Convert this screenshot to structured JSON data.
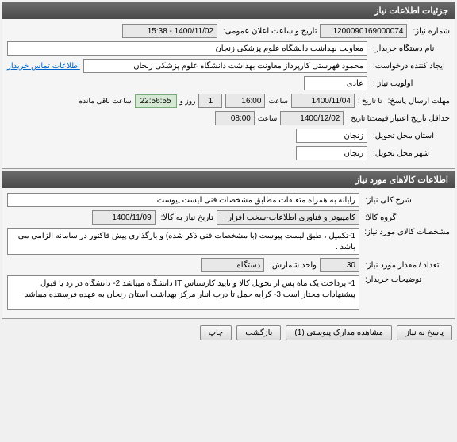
{
  "panel1": {
    "title": "جزئیات اطلاعات نیاز",
    "need_no_label": "شماره نیاز:",
    "need_no": "1200090169000074",
    "pub_label": "تاریخ و ساعت اعلان عمومی:",
    "pub_value": "1400/11/02 - 15:38",
    "buyer_org_label": "نام دستگاه خریدار:",
    "buyer_org": "معاونت بهداشت دانشگاه علوم پزشکی زنجان",
    "creator_label": "ایجاد کننده درخواست:",
    "creator": "محمود فهرستی کارپرداز معاونت بهداشت دانشگاه علوم پزشکی زنجان",
    "contact_link": "اطلاعات تماس خریدار",
    "priority_label": "اولویت نیاز :",
    "priority": "عادی",
    "resp_deadline_label": "مهلت ارسال پاسخ:",
    "to_date_label": "تا تاریخ :",
    "resp_date": "1400/11/04",
    "time_label": "ساعت",
    "resp_time": "16:00",
    "remain_days": "1",
    "remain_days_label": "روز و",
    "remain_clock": "22:56:55",
    "remain_suffix": "ساعت باقی مانده",
    "validity_label": "حداقل تاریخ اعتبار قیمت:",
    "validity_date": "1400/12/02",
    "validity_time": "08:00",
    "delivery_prov_label": "استان محل تحویل:",
    "delivery_prov": "زنجان",
    "delivery_city_label": "شهر محل تحویل:",
    "delivery_city": "زنجان"
  },
  "panel2": {
    "title": "اطلاعات کالاهای مورد نیاز",
    "desc_label": "شرح کلی نیاز:",
    "desc": "رایانه به همراه متعلقات مطابق مشخصات فنی لیست پیوست",
    "group_label": "گروه کالا:",
    "group": "کامپیوتر و فناوری اطلاعات-سخت افزار",
    "need_to_date_label": "تاریخ نیاز به کالا:",
    "need_to_date": "1400/11/09",
    "spec_label": "مشخصات کالای مورد نیاز:",
    "spec": "1-تکمیل ، طبق لیست پیوست (با مشخصات فنی ذکر شده) و بارگذاری پیش فاکتور در سامانه الزامی می باشد .",
    "qty_label": "تعداد / مقدار مورد نیاز:",
    "qty": "30",
    "unit_label": "واحد شمارش:",
    "unit": "دستگاه",
    "notes_label": "توضیحات خریدار:",
    "notes": "1- پرداخت یک ماه پس از تحویل کالا و تایید کارشناس IT دانشگاه  میباشد 2- دانشگاه در رد یا قبول پیشنهادات مختار است 3- کرایه حمل تا درب انبار مرکز بهداشت استان زنجان به عهده فرسنتده میباشد"
  },
  "buttons": {
    "reply": "پاسخ به نیاز",
    "attachments": "مشاهده مدارک پیوستی (1)",
    "back": "بازگشت",
    "print": "چاپ"
  }
}
